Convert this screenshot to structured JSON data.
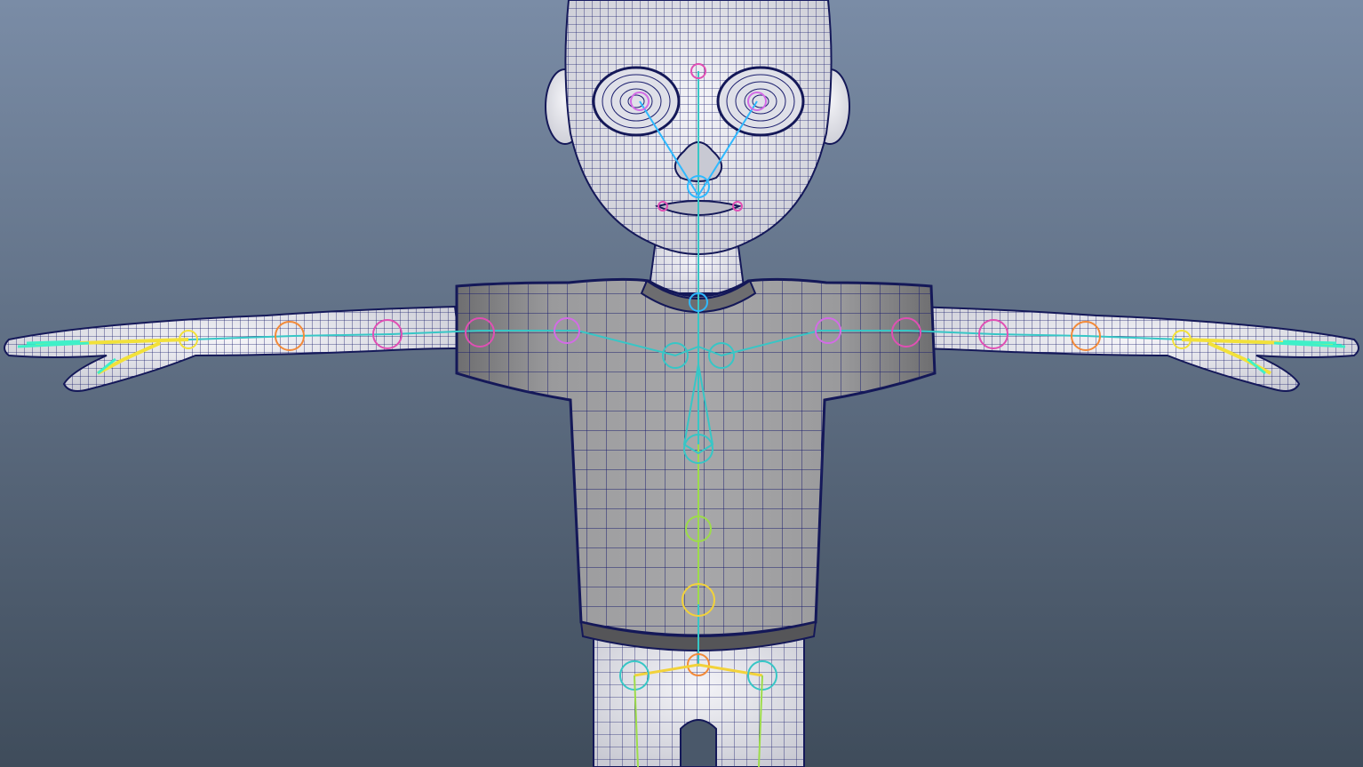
{
  "viewport": {
    "background_top": "#7a8ca6",
    "background_bottom": "#3f4c5b"
  },
  "model": {
    "skin_color": "#e8e9ee",
    "shirt_color": "#8c8c8e",
    "wire_color": "#1c1f6e",
    "outline_color": "#141858"
  },
  "rig": {
    "spine_color": "#37c6c6",
    "arm_color": "#2fb9ff",
    "hand_color": "#f2e13a",
    "finger_color": "#3ff0c8",
    "face_color": "#d36be6",
    "hip_color": "#f2d23a",
    "leg_color": "#9ddc4a",
    "joint_pink": "#e04fb4",
    "joint_orange": "#f28a3a"
  }
}
